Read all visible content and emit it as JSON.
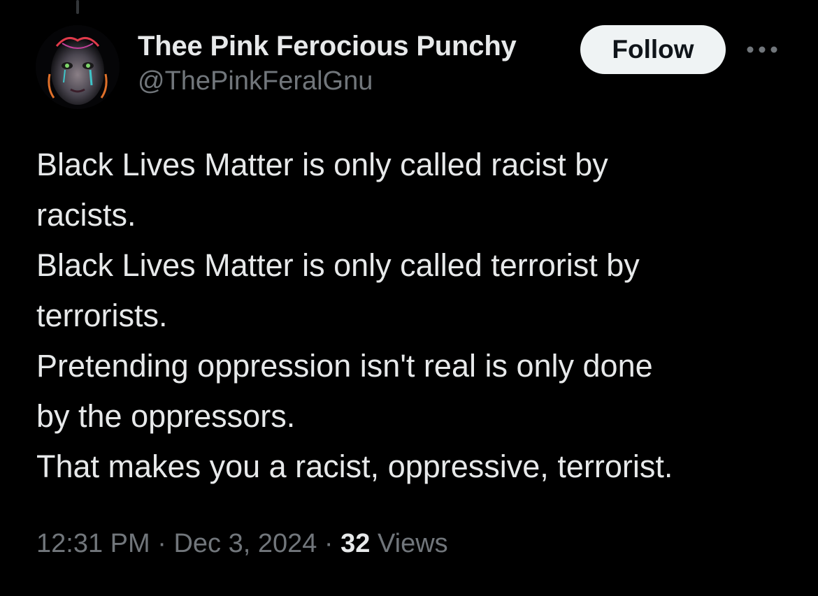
{
  "author": {
    "display_name": "Thee Pink Ferocious Punchy",
    "handle": "@ThePinkFeralGnu",
    "avatar_icon": "profile-avatar-image"
  },
  "actions": {
    "follow_label": "Follow",
    "more_icon": "more-dots-icon"
  },
  "tweet": {
    "lines": [
      "Black Lives Matter is only called racist by",
      "racists.",
      "Black Lives Matter is only called terrorist by",
      "terrorists.",
      "Pretending oppression isn't real is only done",
      "by the oppressors.",
      "That makes you a racist, oppressive, terrorist."
    ]
  },
  "meta": {
    "time": "12:31 PM",
    "separator": "·",
    "date": "Dec 3, 2024",
    "views_count": "32",
    "views_label": "Views"
  },
  "colors": {
    "background": "#000000",
    "primary_text": "#e7e9ea",
    "secondary_text": "#71767b",
    "follow_bg": "#eff3f4"
  }
}
